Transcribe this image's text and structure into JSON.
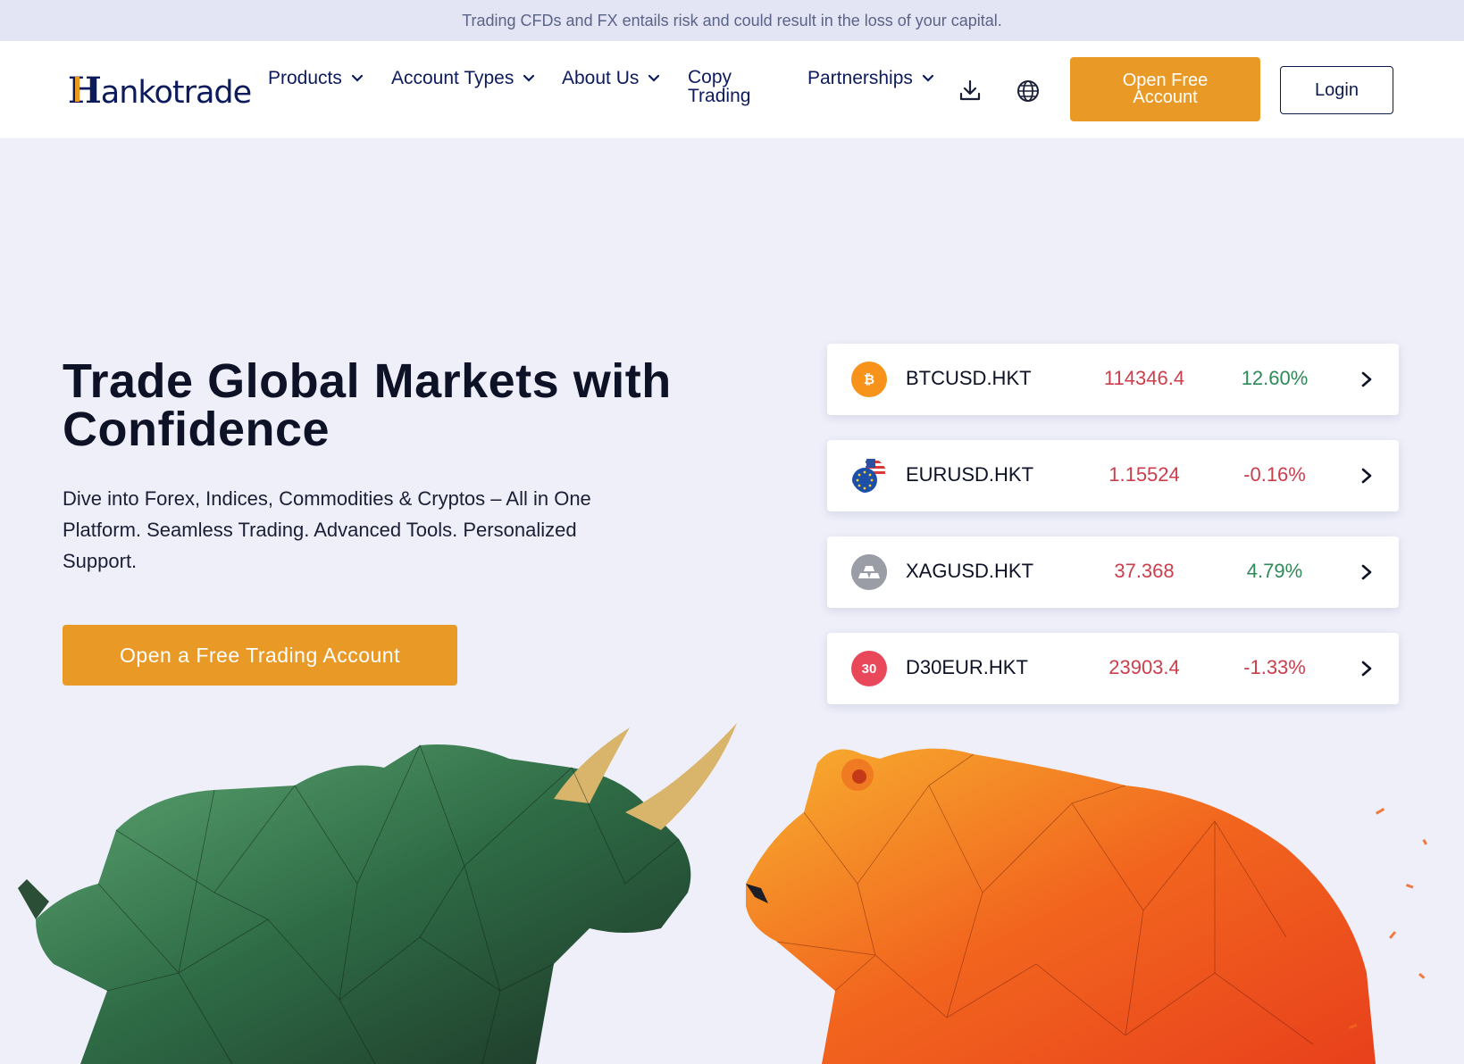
{
  "risk_banner": "Trading CFDs and FX entails risk and could result in the loss of your capital.",
  "logo": {
    "text": "Hankotrade",
    "icon": "hankotrade-logo"
  },
  "nav": {
    "items": [
      {
        "label": "Products",
        "icon": "chevron-down-icon"
      },
      {
        "label": "Account Types",
        "icon": "chevron-down-icon"
      },
      {
        "label": "About Us",
        "icon": "chevron-down-icon"
      },
      {
        "label_line1": "Copy",
        "label_line2": "Trading"
      },
      {
        "label": "Partnerships",
        "icon": "chevron-down-icon"
      }
    ],
    "download_icon": "download-icon",
    "language_icon": "globe-icon",
    "open_account_label": "Open Free Account",
    "login_label": "Login"
  },
  "hero": {
    "title_line1": "Trade Global Markets with",
    "title_line2": "Confidence",
    "subtitle": "Dive into Forex, Indices, Commodities & Cryptos – All in One Platform. Seamless Trading. Advanced Tools. Personalized Support.",
    "cta_label": "Open a Free Trading Account"
  },
  "tickers": [
    {
      "symbol": "BTCUSD.HKT",
      "price": "114346.4",
      "change": "12.60%",
      "direction": "up",
      "icon": "bitcoin-icon",
      "icon_text": "₿",
      "icon_color": "#f7931a"
    },
    {
      "symbol": "EURUSD.HKT",
      "price": "1.15524",
      "change": "-0.16%",
      "direction": "down",
      "icon": "eu-us-flag-icon",
      "icon_text": "",
      "icon_color": "#1e4fa8"
    },
    {
      "symbol": "XAGUSD.HKT",
      "price": "37.368",
      "change": "4.79%",
      "direction": "up",
      "icon": "silver-bars-icon",
      "icon_text": "",
      "icon_color": "#9a9ca6"
    },
    {
      "symbol": "D30EUR.HKT",
      "price": "23903.4",
      "change": "-1.33%",
      "direction": "down",
      "icon": "index-30-icon",
      "icon_text": "30",
      "icon_color": "#e8485a"
    }
  ],
  "colors": {
    "accent": "#e99a26",
    "navy": "#0d1b5c",
    "up": "#2d8a57",
    "down": "#cc3e4c",
    "background": "#eeeff9"
  },
  "hero_art": {
    "left": "green-bull-illustration",
    "right": "orange-bear-illustration"
  }
}
